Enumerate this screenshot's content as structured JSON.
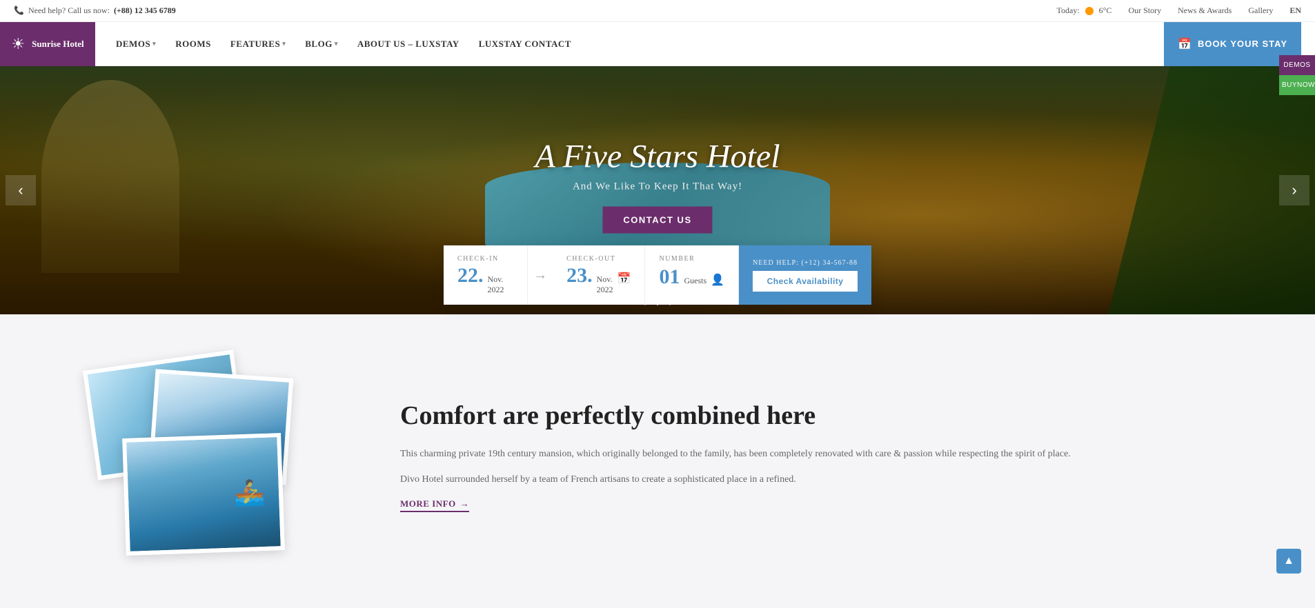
{
  "topbar": {
    "phone_label": "Need help? Call us now:",
    "phone_number": "(+88) 12 345 6789",
    "weather_label": "Today:",
    "temperature": "6°C",
    "nav_links": [
      {
        "id": "our-story",
        "label": "Our Story"
      },
      {
        "id": "news-awards",
        "label": "News & Awards"
      },
      {
        "id": "gallery",
        "label": "Gallery"
      },
      {
        "id": "lang",
        "label": "EN"
      }
    ]
  },
  "logo": {
    "icon": "☀",
    "name": "Sunrise Hotel"
  },
  "nav": {
    "items": [
      {
        "id": "demos",
        "label": "DEMOS",
        "has_dropdown": true
      },
      {
        "id": "rooms",
        "label": "ROOMS",
        "has_dropdown": false
      },
      {
        "id": "features",
        "label": "FEATURES",
        "has_dropdown": true
      },
      {
        "id": "blog",
        "label": "BLOG",
        "has_dropdown": true
      },
      {
        "id": "about",
        "label": "ABOUT US – LUXSTAY",
        "has_dropdown": false
      },
      {
        "id": "contact",
        "label": "LUXSTAY CONTACT",
        "has_dropdown": false
      }
    ],
    "book_label": "BOOK YOUR STAY"
  },
  "hero": {
    "title": "A Five Stars Hotel",
    "subtitle": "And We Like To Keep It That Way!",
    "cta_label": "CONTACT US",
    "prev_label": "‹",
    "next_label": "›"
  },
  "booking": {
    "checkin_label": "CHECK-IN",
    "checkin_day": "22.",
    "checkin_month": "Nov. 2022",
    "arrow": "→",
    "checkout_label": "CHECK-OUT",
    "checkout_day": "23.",
    "checkout_month": "Nov. 2022",
    "number_label": "NUMBER",
    "guests_count": "01",
    "guests_label": "Guests",
    "help_label": "NEED HELP:",
    "help_phone": "(+12) 34-567-88",
    "check_btn": "Check Availability"
  },
  "about": {
    "title": "Comfort are perfectly combined here",
    "desc1": "This charming private 19th century mansion, which originally belonged to the family, has been completely renovated with care & passion while respecting the spirit of place.",
    "desc2": "Divo Hotel surrounded herself by a team of French artisans to create a sophisticated place in a refined.",
    "more_label": "MORE INFO",
    "more_arrow": "→"
  },
  "widgets": {
    "demos_label": "Demos",
    "buynow_label": "BuyNow"
  },
  "scroll_top_icon": "▲"
}
